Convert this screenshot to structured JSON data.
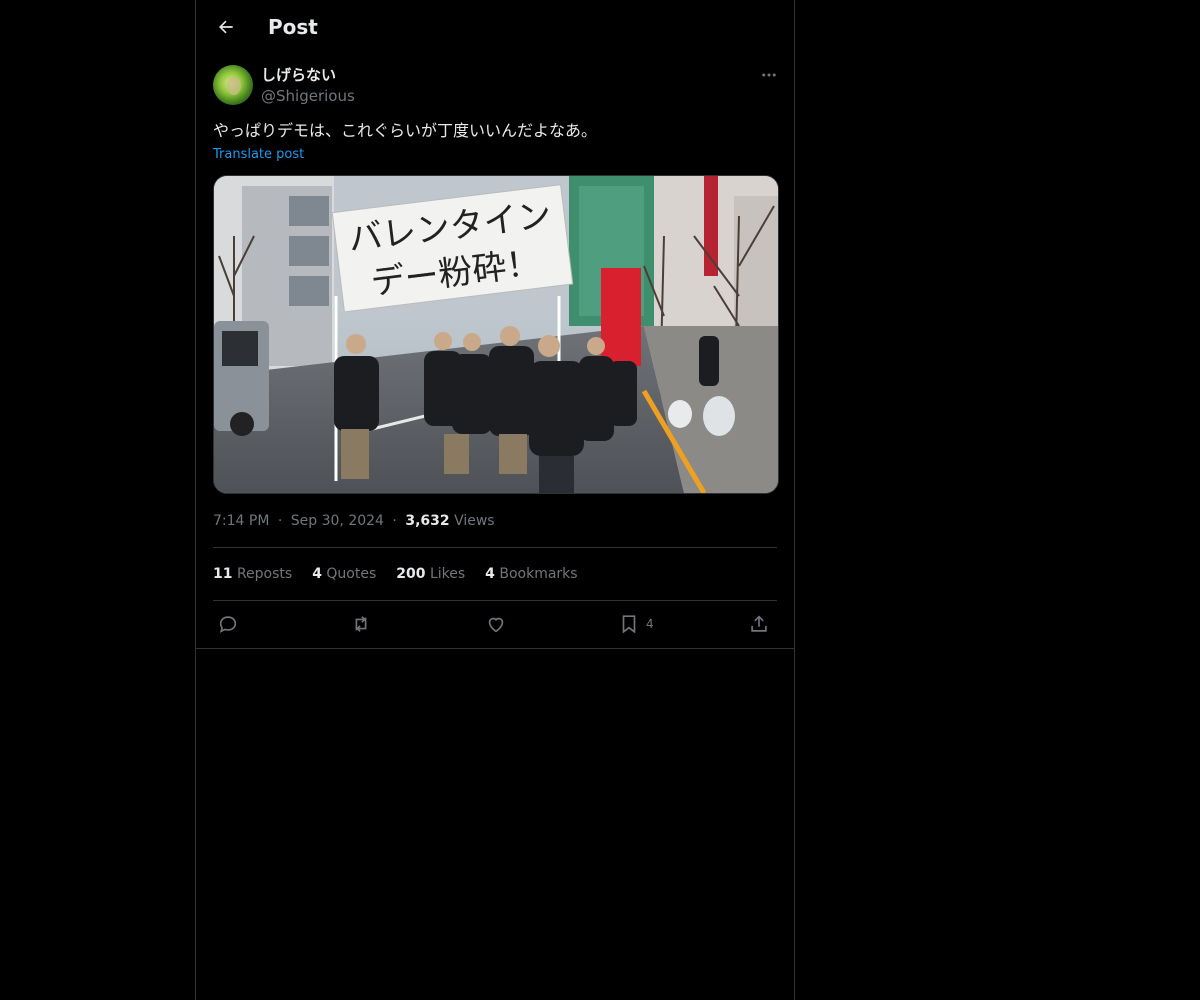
{
  "header": {
    "title": "Post"
  },
  "post": {
    "display_name": "しげらない",
    "handle": "@Shigerious",
    "text": "やっぱりデモは、これぐらいが丁度いいんだよなあ。",
    "translate_label": "Translate post",
    "image": {
      "banner_line1": "バレンタイン",
      "banner_line2": "デー粉砕！"
    },
    "time": "7:14 PM",
    "date": "Sep 30, 2024",
    "separator": "·",
    "views_count": "3,632",
    "views_label": "Views"
  },
  "stats": {
    "reposts_count": "11",
    "reposts_label": "Reposts",
    "quotes_count": "4",
    "quotes_label": "Quotes",
    "likes_count": "200",
    "likes_label": "Likes",
    "bookmarks_count": "4",
    "bookmarks_label": "Bookmarks"
  },
  "actions": {
    "reply_icon": "reply-icon",
    "repost_icon": "repost-icon",
    "like_icon": "heart-icon",
    "bookmark_icon": "bookmark-icon",
    "bookmark_count": "4",
    "share_icon": "share-icon"
  },
  "colors": {
    "background": "#000000",
    "text": "#e7e9ea",
    "muted": "#71767b",
    "accent": "#1d9bf0",
    "border": "#2f3336"
  }
}
